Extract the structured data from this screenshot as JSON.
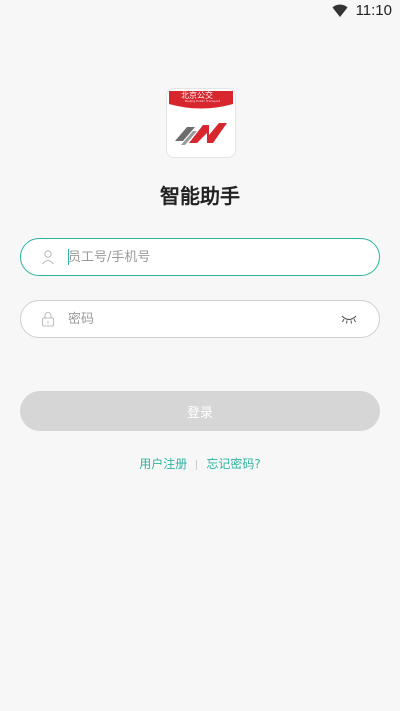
{
  "status_bar": {
    "time": "11:10"
  },
  "app": {
    "title": "智能助手",
    "logo_banner_text": "北京公交",
    "logo_banner_sub": "Beijing Public Transport"
  },
  "form": {
    "username_placeholder": "员工号/手机号",
    "password_placeholder": "密码",
    "login_label": "登录"
  },
  "links": {
    "register": "用户注册",
    "forgot_password": "忘记密码?"
  },
  "colors": {
    "accent": "#2bb5a0",
    "button_disabled": "#d6d6d6",
    "logo_red": "#d7262e"
  },
  "icons": [
    "wifi-icon",
    "user-icon",
    "lock-icon",
    "eye-closed-icon"
  ]
}
